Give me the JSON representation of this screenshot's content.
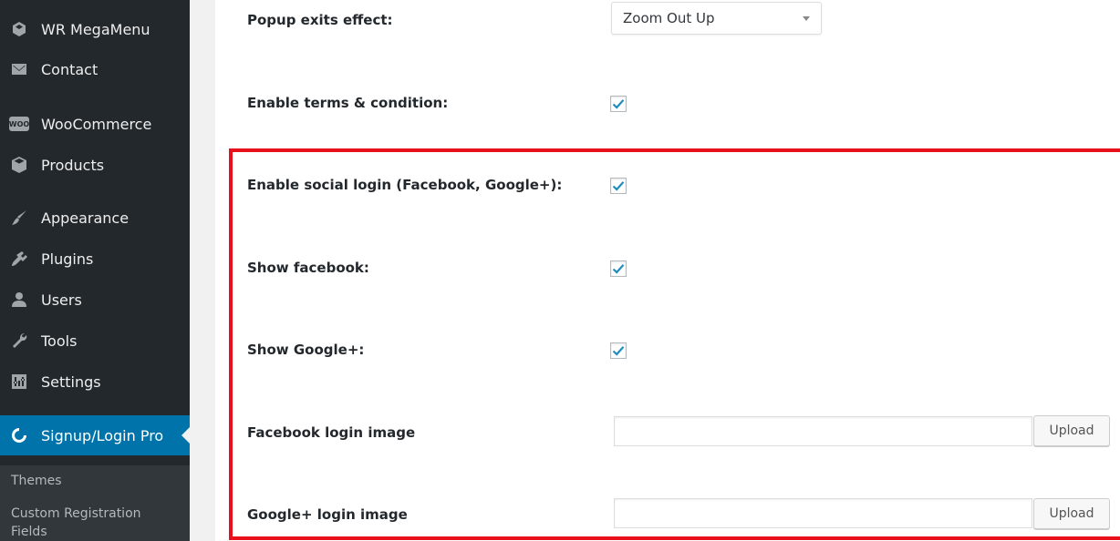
{
  "sidebar": {
    "items": [
      {
        "label": "WR MegaMenu",
        "icon": "megamenu-icon"
      },
      {
        "label": "Contact",
        "icon": "envelope-icon"
      },
      {
        "label": "WooCommerce",
        "icon": "woocommerce-icon",
        "badge": "WOO"
      },
      {
        "label": "Products",
        "icon": "box-icon"
      },
      {
        "label": "Appearance",
        "icon": "paintbrush-icon"
      },
      {
        "label": "Plugins",
        "icon": "plugin-icon"
      },
      {
        "label": "Users",
        "icon": "user-icon"
      },
      {
        "label": "Tools",
        "icon": "wrench-icon"
      },
      {
        "label": "Settings",
        "icon": "settings-icon"
      },
      {
        "label": "Signup/Login Pro",
        "icon": "signup-login-icon",
        "active": true
      }
    ],
    "submenu": [
      {
        "label": "Themes"
      },
      {
        "label": "Custom Registration"
      },
      {
        "label": "Fields"
      }
    ]
  },
  "form": {
    "popup_exits_effect": {
      "label": "Popup exits effect:",
      "value": "Zoom Out Up"
    },
    "enable_terms": {
      "label": "Enable terms & condition:",
      "checked": true
    },
    "enable_social_login": {
      "label": "Enable social login (Facebook, Google+):",
      "checked": true
    },
    "show_facebook": {
      "label": "Show facebook:",
      "checked": true
    },
    "show_google": {
      "label": "Show Google+:",
      "checked": true
    },
    "facebook_login_image": {
      "label": "Facebook login image",
      "value": "",
      "button": "Upload"
    },
    "google_login_image": {
      "label": "Google+ login image",
      "value": "",
      "button": "Upload"
    }
  },
  "colors": {
    "sidebar_bg": "#23282d",
    "active_bg": "#0073aa",
    "checkmark": "#1e8cbe",
    "highlight_border": "#e8101a"
  }
}
